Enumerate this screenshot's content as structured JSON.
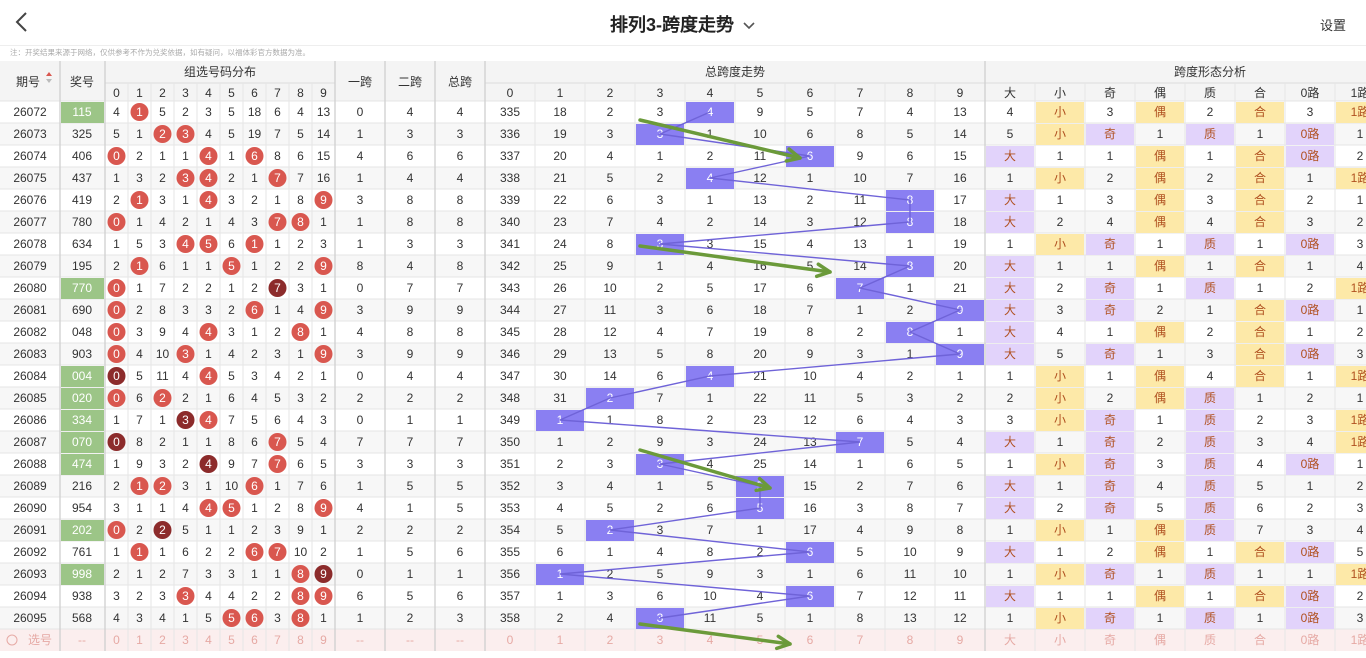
{
  "header": {
    "title": "排列3-跨度走势",
    "settings": "设置"
  },
  "note": "注：开奖结果来源于网络，仅供参考不作为兑奖依据，如有疑问，以福体彩官方数据为准。",
  "table": {
    "col_period": "期号",
    "col_prize": "奖号",
    "group_title": "组选号码分布",
    "col_span1": "一跨",
    "col_span2": "二跨",
    "col_spantotal": "总跨",
    "trend_title": "总跨度走势",
    "analysis_title": "跨度形态分析",
    "analysis_cols": [
      "大",
      "小",
      "奇",
      "偶",
      "质",
      "合",
      "0路",
      "1路"
    ],
    "footer_label": "选号",
    "footer_dash": "--"
  },
  "rows": [
    {
      "period": "26072",
      "prize": "115",
      "grp": [
        4,
        1,
        5,
        2,
        3,
        5,
        18,
        6,
        4,
        13
      ],
      "s1": 0,
      "s2": 4,
      "st": 4,
      "trend": [
        335,
        18,
        2,
        3,
        4,
        9,
        5,
        7,
        4,
        13
      ],
      "an": [
        4,
        "小",
        3,
        "偶",
        2,
        "合",
        3,
        "1路"
      ]
    },
    {
      "period": "26073",
      "prize": "325",
      "grp": [
        5,
        1,
        2,
        3,
        4,
        5,
        19,
        7,
        5,
        14
      ],
      "s1": 1,
      "s2": 3,
      "st": 3,
      "trend": [
        336,
        19,
        3,
        3,
        1,
        10,
        6,
        8,
        5,
        14
      ],
      "an": [
        5,
        "小",
        "奇",
        1,
        "质",
        1,
        "0路",
        1
      ]
    },
    {
      "period": "26074",
      "prize": "406",
      "grp": [
        0,
        2,
        1,
        1,
        4,
        1,
        6,
        8,
        6,
        15
      ],
      "s1": 4,
      "s2": 6,
      "st": 6,
      "trend": [
        337,
        20,
        4,
        1,
        2,
        11,
        6,
        9,
        6,
        15
      ],
      "an": [
        "大",
        1,
        1,
        "偶",
        1,
        "合",
        "0路",
        2
      ]
    },
    {
      "period": "26075",
      "prize": "437",
      "grp": [
        1,
        3,
        2,
        3,
        4,
        2,
        1,
        7,
        7,
        16
      ],
      "s1": 1,
      "s2": 4,
      "st": 4,
      "trend": [
        338,
        21,
        5,
        2,
        4,
        12,
        1,
        10,
        7,
        16
      ],
      "an": [
        1,
        "小",
        2,
        "偶",
        2,
        "合",
        1,
        "1路"
      ]
    },
    {
      "period": "26076",
      "prize": "419",
      "grp": [
        2,
        1,
        3,
        1,
        4,
        3,
        2,
        1,
        8,
        9
      ],
      "s1": 3,
      "s2": 8,
      "st": 8,
      "trend": [
        339,
        22,
        6,
        3,
        1,
        13,
        2,
        11,
        8,
        17
      ],
      "an": [
        "大",
        1,
        3,
        "偶",
        3,
        "合",
        2,
        1
      ]
    },
    {
      "period": "26077",
      "prize": "780",
      "grp": [
        0,
        1,
        4,
        2,
        1,
        4,
        3,
        7,
        8,
        1
      ],
      "s1": 1,
      "s2": 8,
      "st": 8,
      "trend": [
        340,
        23,
        7,
        4,
        2,
        14,
        3,
        12,
        8,
        18
      ],
      "an": [
        "大",
        2,
        4,
        "偶",
        4,
        "合",
        3,
        2
      ]
    },
    {
      "period": "26078",
      "prize": "634",
      "grp": [
        1,
        5,
        3,
        4,
        5,
        6,
        1,
        1,
        2,
        3
      ],
      "s1": 1,
      "s2": 3,
      "st": 3,
      "trend": [
        341,
        24,
        8,
        3,
        3,
        15,
        4,
        13,
        1,
        19
      ],
      "an": [
        1,
        "小",
        "奇",
        1,
        "质",
        1,
        "0路",
        3
      ]
    },
    {
      "period": "26079",
      "prize": "195",
      "grp": [
        2,
        1,
        6,
        1,
        1,
        5,
        1,
        2,
        2,
        9
      ],
      "s1": 8,
      "s2": 4,
      "st": 8,
      "trend": [
        342,
        25,
        9,
        1,
        4,
        16,
        5,
        14,
        8,
        20
      ],
      "an": [
        "大",
        1,
        1,
        "偶",
        1,
        "合",
        1,
        4
      ]
    },
    {
      "period": "26080",
      "prize": "770",
      "grp": [
        0,
        1,
        7,
        2,
        2,
        1,
        2,
        7,
        3,
        1
      ],
      "s1": 0,
      "s2": 7,
      "st": 7,
      "trend": [
        343,
        26,
        10,
        2,
        5,
        17,
        6,
        7,
        1,
        21
      ],
      "an": [
        "大",
        2,
        "奇",
        1,
        "质",
        1,
        2,
        "1路"
      ]
    },
    {
      "period": "26081",
      "prize": "690",
      "grp": [
        0,
        2,
        8,
        3,
        3,
        2,
        6,
        1,
        4,
        9
      ],
      "s1": 3,
      "s2": 9,
      "st": 9,
      "trend": [
        344,
        27,
        11,
        3,
        6,
        18,
        7,
        1,
        2,
        9
      ],
      "an": [
        "大",
        3,
        "奇",
        2,
        1,
        "合",
        "0路",
        1
      ]
    },
    {
      "period": "26082",
      "prize": "048",
      "grp": [
        0,
        3,
        9,
        4,
        4,
        3,
        1,
        2,
        8,
        1
      ],
      "s1": 4,
      "s2": 8,
      "st": 8,
      "trend": [
        345,
        28,
        12,
        4,
        7,
        19,
        8,
        2,
        8,
        1
      ],
      "an": [
        "大",
        4,
        1,
        "偶",
        2,
        "合",
        1,
        2
      ]
    },
    {
      "period": "26083",
      "prize": "903",
      "grp": [
        0,
        4,
        10,
        3,
        1,
        4,
        2,
        3,
        1,
        9
      ],
      "s1": 3,
      "s2": 9,
      "st": 9,
      "trend": [
        346,
        29,
        13,
        5,
        8,
        20,
        9,
        3,
        1,
        9
      ],
      "an": [
        "大",
        5,
        "奇",
        1,
        3,
        "合",
        "0路",
        3
      ]
    },
    {
      "period": "26084",
      "prize": "004",
      "grp": [
        0,
        5,
        11,
        4,
        4,
        5,
        3,
        4,
        2,
        1
      ],
      "s1": 0,
      "s2": 4,
      "st": 4,
      "trend": [
        347,
        30,
        14,
        6,
        4,
        21,
        10,
        4,
        2,
        1
      ],
      "an": [
        1,
        "小",
        1,
        "偶",
        4,
        "合",
        1,
        "1路"
      ]
    },
    {
      "period": "26085",
      "prize": "020",
      "grp": [
        0,
        6,
        2,
        2,
        1,
        6,
        4,
        5,
        3,
        2
      ],
      "s1": 2,
      "s2": 2,
      "st": 2,
      "trend": [
        348,
        31,
        2,
        7,
        1,
        22,
        11,
        5,
        3,
        2
      ],
      "an": [
        2,
        "小",
        2,
        "偶",
        "质",
        1,
        2,
        1
      ]
    },
    {
      "period": "26086",
      "prize": "334",
      "grp": [
        1,
        7,
        1,
        3,
        4,
        7,
        5,
        6,
        4,
        3
      ],
      "s1": 0,
      "s2": 1,
      "st": 1,
      "trend": [
        349,
        1,
        1,
        8,
        2,
        23,
        12,
        6,
        4,
        3
      ],
      "an": [
        3,
        "小",
        "奇",
        1,
        "质",
        2,
        3,
        "1路"
      ]
    },
    {
      "period": "26087",
      "prize": "070",
      "grp": [
        0,
        8,
        2,
        1,
        1,
        8,
        6,
        7,
        5,
        4
      ],
      "s1": 7,
      "s2": 7,
      "st": 7,
      "trend": [
        350,
        1,
        2,
        9,
        3,
        24,
        13,
        7,
        5,
        4
      ],
      "an": [
        "大",
        1,
        "奇",
        2,
        "质",
        3,
        4,
        "1路"
      ]
    },
    {
      "period": "26088",
      "prize": "474",
      "grp": [
        1,
        9,
        3,
        2,
        4,
        9,
        7,
        7,
        6,
        5
      ],
      "s1": 3,
      "s2": 3,
      "st": 3,
      "trend": [
        351,
        2,
        3,
        3,
        4,
        25,
        14,
        1,
        6,
        5
      ],
      "an": [
        1,
        "小",
        "奇",
        3,
        "质",
        4,
        "0路",
        1
      ]
    },
    {
      "period": "26089",
      "prize": "216",
      "grp": [
        2,
        1,
        2,
        3,
        1,
        10,
        6,
        1,
        7,
        6
      ],
      "s1": 1,
      "s2": 5,
      "st": 5,
      "trend": [
        352,
        3,
        4,
        1,
        5,
        5,
        15,
        2,
        7,
        6
      ],
      "an": [
        "大",
        1,
        "奇",
        4,
        "质",
        5,
        1,
        2
      ]
    },
    {
      "period": "26090",
      "prize": "954",
      "grp": [
        3,
        1,
        1,
        4,
        4,
        5,
        1,
        2,
        8,
        9
      ],
      "s1": 4,
      "s2": 1,
      "st": 5,
      "trend": [
        353,
        4,
        5,
        2,
        6,
        5,
        16,
        3,
        8,
        7
      ],
      "an": [
        "大",
        2,
        "奇",
        5,
        "质",
        6,
        2,
        3
      ]
    },
    {
      "period": "26091",
      "prize": "202",
      "grp": [
        0,
        2,
        2,
        5,
        1,
        1,
        2,
        3,
        9,
        1
      ],
      "s1": 2,
      "s2": 2,
      "st": 2,
      "trend": [
        354,
        5,
        2,
        3,
        7,
        1,
        17,
        4,
        9,
        8
      ],
      "an": [
        1,
        "小",
        1,
        "偶",
        "质",
        7,
        3,
        4
      ]
    },
    {
      "period": "26092",
      "prize": "761",
      "grp": [
        1,
        1,
        1,
        6,
        2,
        2,
        6,
        7,
        10,
        2
      ],
      "s1": 1,
      "s2": 5,
      "st": 6,
      "trend": [
        355,
        6,
        1,
        4,
        8,
        2,
        6,
        5,
        10,
        9
      ],
      "an": [
        "大",
        1,
        2,
        "偶",
        1,
        "合",
        "0路",
        5
      ]
    },
    {
      "period": "26093",
      "prize": "998",
      "grp": [
        2,
        1,
        2,
        7,
        3,
        3,
        1,
        1,
        8,
        9
      ],
      "s1": 0,
      "s2": 1,
      "st": 1,
      "trend": [
        356,
        1,
        2,
        5,
        9,
        3,
        1,
        6,
        11,
        10
      ],
      "an": [
        1,
        "小",
        "奇",
        1,
        "质",
        1,
        1,
        "1路"
      ]
    },
    {
      "period": "26094",
      "prize": "938",
      "grp": [
        3,
        2,
        3,
        3,
        4,
        4,
        2,
        2,
        8,
        9
      ],
      "s1": 6,
      "s2": 5,
      "st": 6,
      "trend": [
        357,
        1,
        3,
        6,
        10,
        4,
        6,
        7,
        12,
        11
      ],
      "an": [
        "大",
        1,
        1,
        "偶",
        1,
        "合",
        "0路",
        2
      ]
    },
    {
      "period": "26095",
      "prize": "568",
      "grp": [
        4,
        3,
        4,
        1,
        5,
        5,
        6,
        3,
        8,
        1
      ],
      "s1": 1,
      "s2": 2,
      "st": 3,
      "trend": [
        358,
        2,
        4,
        3,
        11,
        5,
        1,
        8,
        13,
        12
      ],
      "an": [
        1,
        "小",
        "奇",
        1,
        "质",
        1,
        "0路",
        3
      ]
    }
  ],
  "circles": [
    [
      1
    ],
    [
      2,
      3
    ],
    [
      0,
      4,
      6
    ],
    [
      3,
      4,
      7
    ],
    [
      1,
      4,
      9
    ],
    [
      0,
      7,
      8
    ],
    [
      3,
      4,
      6
    ],
    [
      1,
      5,
      9
    ],
    [
      0,
      7
    ],
    [
      0,
      6,
      9
    ],
    [
      0,
      4,
      8
    ],
    [
      0,
      3,
      9
    ],
    [
      0,
      4
    ],
    [
      0,
      2
    ],
    [
      3,
      4
    ],
    [
      0,
      7
    ],
    [
      4,
      7
    ],
    [
      1,
      2,
      6
    ],
    [
      4,
      5,
      9
    ],
    [
      0,
      2
    ],
    [
      1,
      6,
      7
    ],
    [
      8,
      9
    ],
    [
      3,
      8,
      9
    ],
    [
      5,
      6,
      8
    ]
  ],
  "dark_circles": [
    [],
    [],
    [],
    [],
    [],
    [],
    [],
    [],
    [
      7
    ],
    [],
    [],
    [],
    [
      0
    ],
    [],
    [
      3
    ],
    [
      0
    ],
    [
      4
    ],
    [],
    [],
    [
      2
    ],
    [],
    [
      9
    ],
    [],
    []
  ],
  "highlight_prize": [
    0,
    8,
    12,
    13,
    14,
    15,
    16,
    19,
    21
  ],
  "colors": {
    "purple": "#8a7ff2",
    "red": "#d9574f",
    "darkred": "#8c2b2b",
    "green": "#6b9a3a",
    "prizebg": "#9cc587"
  }
}
